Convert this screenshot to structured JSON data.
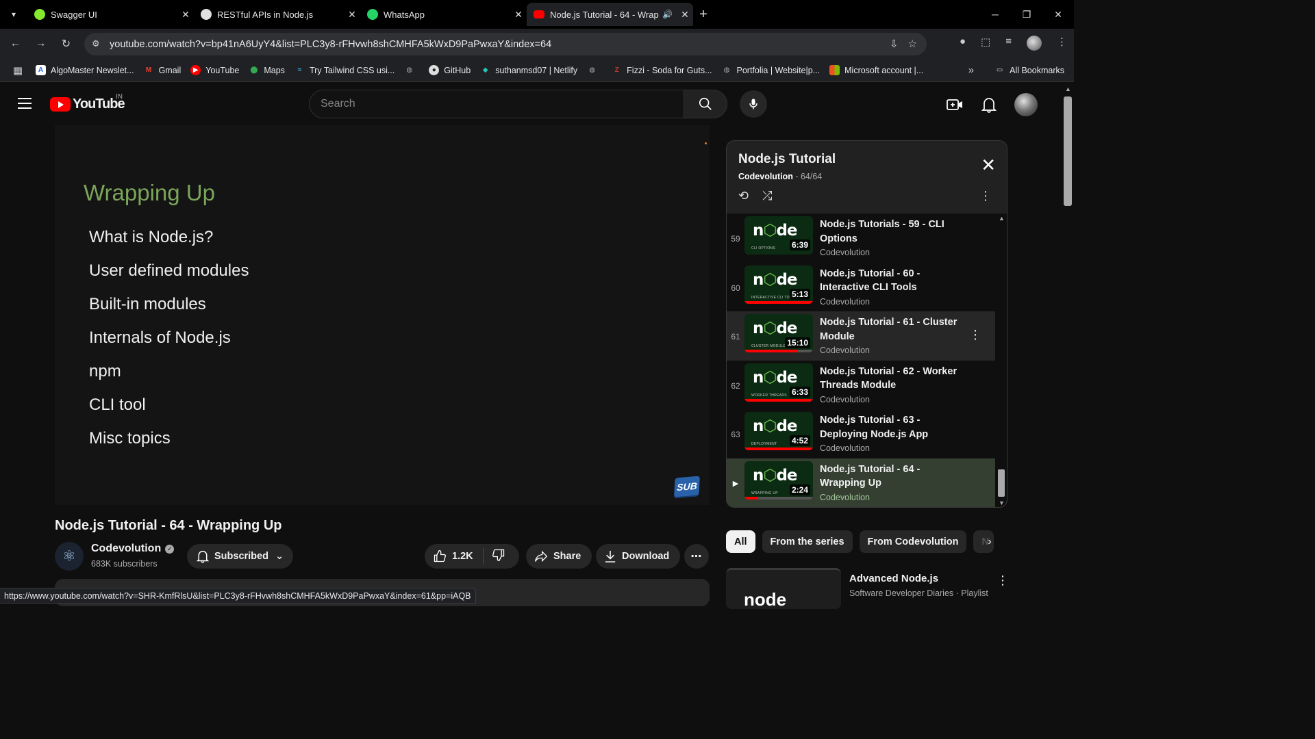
{
  "browser": {
    "tabs": [
      {
        "title": "Swagger UI",
        "favicon_color": "#85ea2d"
      },
      {
        "title": "RESTful APIs in Node.js",
        "favicon_color": "#e0e0e0"
      },
      {
        "title": "WhatsApp",
        "favicon_color": "#25d366"
      },
      {
        "title": "Node.js Tutorial - 64 - Wrap",
        "favicon_color": "#ff0000"
      }
    ],
    "url": "youtube.com/watch?v=bp41nA6UyY4&list=PLC3y8-rFHvwh8shCMHFA5kWxD9PaPwxaY&index=64",
    "bookmarks": [
      "AlgoMaster Newslet...",
      "Gmail",
      "YouTube",
      "Maps",
      "Try Tailwind CSS usi...",
      "",
      "GitHub",
      "suthanmsd07 | Netlify",
      "",
      "Fizzi - Soda for Guts...",
      "Portfolia | Website|p...",
      "Microsoft account |..."
    ],
    "all_bookmarks": "All Bookmarks",
    "status_url": "https://www.youtube.com/watch?v=SHR-KmfRlsU&list=PLC3y8-rFHvwh8shCMHFA5kWxD9PaPwxaY&index=61&pp=iAQB"
  },
  "youtube": {
    "logo_text": "YouTube",
    "country": "IN",
    "search_placeholder": "Search",
    "accent": "#ff0000"
  },
  "player": {
    "slide_title": "Wrapping Up",
    "topics": [
      "What is Node.js?",
      "User defined modules",
      "Built-in modules",
      "Internals of Node.js",
      "npm",
      "CLI tool",
      "Misc topics"
    ],
    "badge": "SUB"
  },
  "video": {
    "title": "Node.js Tutorial - 64 - Wrapping Up",
    "channel": "Codevolution",
    "subscribers": "683K subscribers",
    "subscribed_label": "Subscribed",
    "likes": "1.2K",
    "share_label": "Share",
    "download_label": "Download"
  },
  "playlist": {
    "title": "Node.js Tutorial",
    "channel": "Codevolution",
    "position": " - 64/64",
    "items": [
      {
        "index": "59",
        "title": "Node.js Tutorials - 59 - CLI Options",
        "channel": "Codevolution",
        "duration": "6:39",
        "caption": "CLI OPTIONS",
        "progress": 0
      },
      {
        "index": "60",
        "title": "Node.js Tutorial - 60 - Interactive CLI Tools",
        "channel": "Codevolution",
        "duration": "5:13",
        "caption": "INTERACTIVE CLI TOOLS",
        "progress": 1.0
      },
      {
        "index": "61",
        "title": "Node.js Tutorial - 61 - Cluster Module",
        "channel": "Codevolution",
        "duration": "15:10",
        "caption": "CLUSTER MODULE",
        "progress": 0.78
      },
      {
        "index": "62",
        "title": "Node.js Tutorial - 62 - Worker Threads Module",
        "channel": "Codevolution",
        "duration": "6:33",
        "caption": "WORKER THREADS",
        "progress": 1.0
      },
      {
        "index": "63",
        "title": "Node.js Tutorial - 63 - Deploying Node.js App",
        "channel": "Codevolution",
        "duration": "4:52",
        "caption": "DEPLOYMENT",
        "progress": 1.0
      },
      {
        "index": "▶",
        "title": "Node.js Tutorial - 64 - Wrapping Up",
        "channel": "Codevolution",
        "duration": "2:24",
        "caption": "WRAPPING UP",
        "progress": 0.2
      }
    ]
  },
  "chips": [
    "All",
    "From the series",
    "From Codevolution",
    "N"
  ],
  "recommended": {
    "title": "Advanced Node.js",
    "meta": "Software Developer Diaries · Playlist"
  }
}
